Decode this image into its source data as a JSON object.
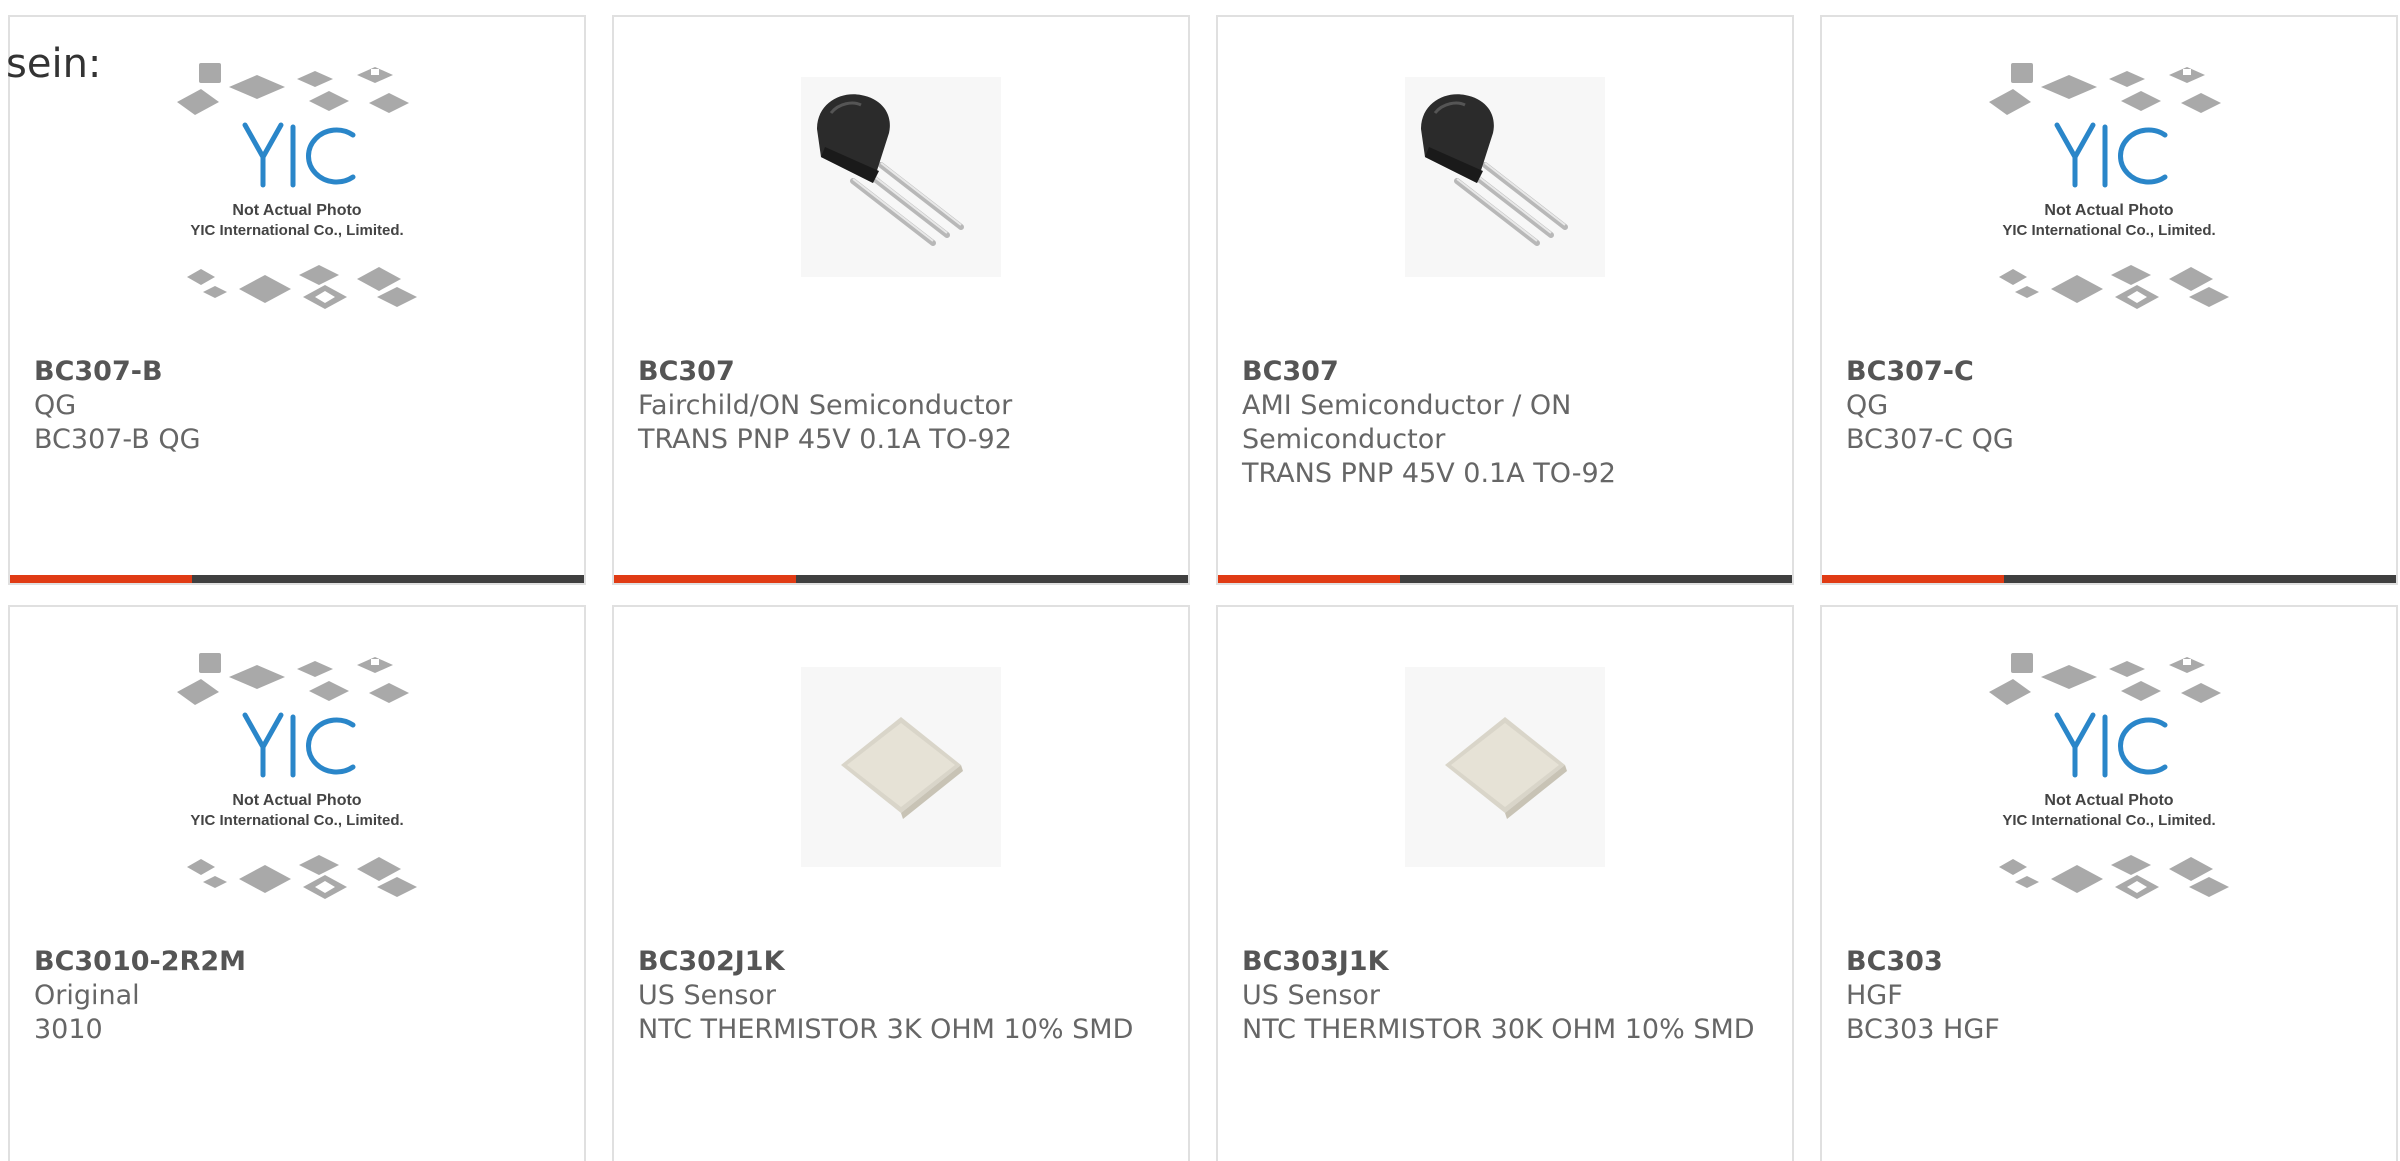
{
  "intro_text": "sein:",
  "colors": {
    "accent": "#e03b14",
    "bar": "#3f3f3f",
    "border": "#e0e0e0",
    "logo": "#2a86c9"
  },
  "placeholder": {
    "line1": "Not Actual Photo",
    "line2": "YIC International Co., Limited."
  },
  "products": [
    {
      "part": "BC307-B",
      "line1": "QG",
      "line2": "BC307-B QG",
      "image": "placeholder-icon"
    },
    {
      "part": "BC307",
      "line1": "Fairchild/ON Semiconductor",
      "line2": "TRANS PNP 45V 0.1A TO-92",
      "image": "transistor-icon"
    },
    {
      "part": "BC307",
      "line1": "AMI Semiconductor / ON Semiconductor",
      "line2": "TRANS PNP 45V 0.1A TO-92",
      "image": "transistor-icon"
    },
    {
      "part": "BC307-C",
      "line1": "QG",
      "line2": "BC307-C QG",
      "image": "placeholder-icon"
    },
    {
      "part": "BC3010-2R2M",
      "line1": "Original",
      "line2": "3010",
      "image": "placeholder-icon"
    },
    {
      "part": "BC302J1K",
      "line1": "US Sensor",
      "line2": "NTC THERMISTOR 3K OHM 10% SMD",
      "image": "thermistor-icon"
    },
    {
      "part": "BC303J1K",
      "line1": "US Sensor",
      "line2": "NTC THERMISTOR 30K OHM 10% SMD",
      "image": "thermistor-icon"
    },
    {
      "part": "BC303",
      "line1": "HGF",
      "line2": "BC303 HGF",
      "image": "placeholder-icon"
    }
  ]
}
